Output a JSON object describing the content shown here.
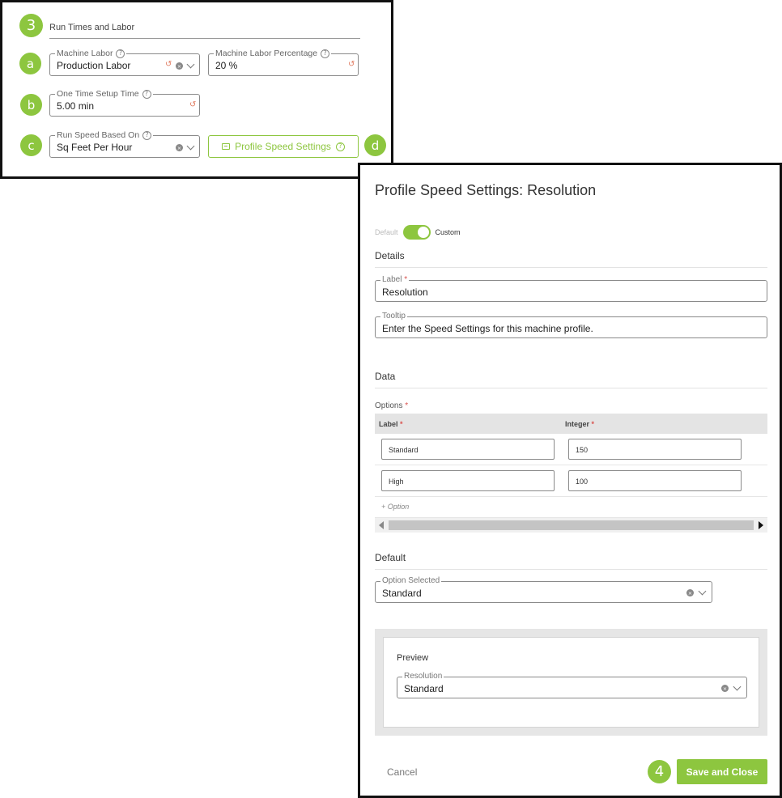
{
  "run_times": {
    "step_number": "3",
    "section_title": "Run Times and Labor",
    "machine_labor": {
      "marker": "a",
      "label": "Machine Labor",
      "value": "Production Labor"
    },
    "labor_percentage": {
      "label": "Machine Labor Percentage",
      "value": "20 %"
    },
    "setup_time": {
      "marker": "b",
      "label": "One Time Setup Time",
      "value": "5.00 min"
    },
    "run_speed": {
      "marker": "c",
      "label": "Run Speed Based On",
      "value": "Sq Feet Per Hour"
    },
    "profile_speed_button": {
      "marker": "d",
      "label": "Profile Speed Settings"
    },
    "help_glyph": "?",
    "reset_glyph": "↺",
    "clear_glyph": "×",
    "accent_color": "#8dc63f"
  },
  "dialog": {
    "title": "Profile Speed Settings: Resolution",
    "toggle": {
      "off_label": "Default",
      "on_label": "Custom",
      "state": "custom"
    },
    "details": {
      "heading": "Details",
      "label_field": {
        "label": "Label",
        "required_mark": "*",
        "value": "Resolution"
      },
      "tooltip_field": {
        "label": "Tooltip",
        "value": "Enter the Speed Settings for this machine profile."
      }
    },
    "data": {
      "heading": "Data",
      "options_label": "Options",
      "required_mark": "*",
      "columns": [
        "Label",
        "Integer"
      ],
      "rows": [
        {
          "label": "Standard",
          "integer": "150"
        },
        {
          "label": "High",
          "integer": "100"
        }
      ],
      "add_option": "+ Option"
    },
    "default": {
      "heading": "Default",
      "option_selected": {
        "label": "Option Selected",
        "value": "Standard"
      }
    },
    "preview": {
      "heading": "Preview",
      "field": {
        "label": "Resolution",
        "value": "Standard"
      }
    },
    "cancel_label": "Cancel",
    "save_step_number": "4",
    "save_label": "Save and Close"
  }
}
